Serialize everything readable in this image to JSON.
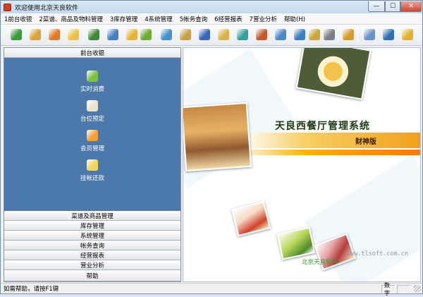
{
  "window": {
    "title": "欢迎使用北京天良软件"
  },
  "menu": [
    "1前台收银",
    "2菜谱、商品及物料管理",
    "3库存管理",
    "4系统管理",
    "5帐务查询",
    "6经营报表",
    "7营业分析",
    "帮助(H)"
  ],
  "toolbar_icons": [
    {
      "name": "checkout-icon",
      "color": "#3a9a3a"
    },
    {
      "name": "clock-icon",
      "color": "#d9a43c"
    },
    {
      "name": "members-icon",
      "color": "#e07a28"
    },
    {
      "name": "sign-icon",
      "color": "#e8c24a"
    },
    {
      "name": "dish-icon",
      "color": "#3f8a3a"
    },
    {
      "name": "edit-icon",
      "color": "#4b7fc2"
    },
    {
      "name": "note-icon",
      "color": "#e5b33a"
    },
    {
      "name": "folder-icon",
      "color": "#6faa34"
    },
    {
      "name": "settings-icon",
      "color": "#4a90c8"
    },
    {
      "name": "search-icon",
      "color": "#c8a24a"
    },
    {
      "name": "book-icon",
      "color": "#3867b5"
    },
    {
      "name": "edit-doc-icon",
      "color": "#d7b54a"
    },
    {
      "name": "report-icon",
      "color": "#36a0a0"
    },
    {
      "name": "chart-icon",
      "color": "#c25b2e"
    },
    {
      "name": "config-icon",
      "color": "#4f86c6"
    },
    {
      "name": "network-icon",
      "color": "#3a7fc0"
    },
    {
      "name": "key-icon",
      "color": "#c9a640"
    },
    {
      "name": "printer-icon",
      "color": "#7a7f88"
    },
    {
      "name": "tools-icon",
      "color": "#d39a2c"
    },
    {
      "name": "document-icon",
      "color": "#6a93c7"
    },
    {
      "name": "user-icon",
      "color": "#2f6fb0"
    },
    {
      "name": "lock-icon",
      "color": "#e2b030"
    }
  ],
  "sidebar": {
    "active_group": "前台收银",
    "entries": [
      {
        "label": "实时消费",
        "icon": "realtime-consume-icon",
        "color": "#7bc142"
      },
      {
        "label": "台位预定",
        "icon": "clock-icon",
        "color": "#e8e3d0"
      },
      {
        "label": "会员管理",
        "icon": "members-icon",
        "color": "#f0a23c"
      },
      {
        "label": "挂帐还款",
        "icon": "sign-icon",
        "color": "#f2d45c"
      }
    ],
    "groups": [
      "菜谱及商品管理",
      "库存管理",
      "系统管理",
      "帐务查询",
      "经营报表",
      "营业分析",
      "帮助"
    ]
  },
  "banner": {
    "title": "天良西餐厅管理系统",
    "edition": "财神版",
    "url": "www.tlsoft.com.cn",
    "company": "北京天良软件"
  },
  "status": {
    "message": "如需帮助，请按F1键",
    "cell": "数字"
  },
  "colors": {
    "sidebar_blue": "#4d78ab",
    "accent_orange": "#ff9a00"
  }
}
